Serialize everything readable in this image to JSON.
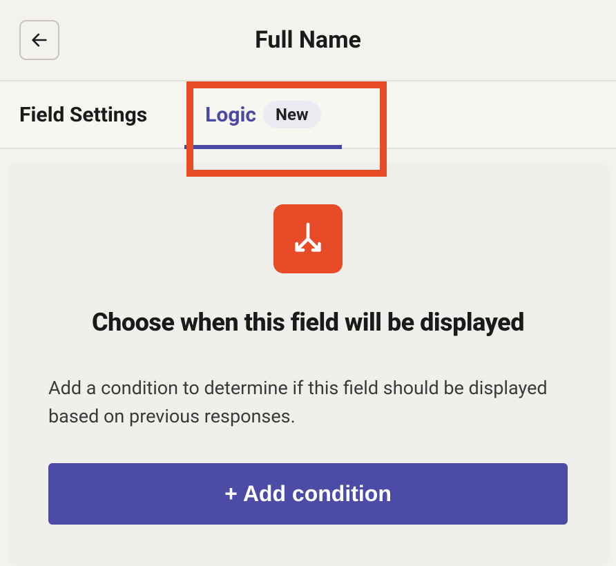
{
  "header": {
    "title": "Full Name"
  },
  "tabs": {
    "fieldSettings": {
      "label": "Field Settings"
    },
    "logic": {
      "label": "Logic",
      "badge": "New"
    }
  },
  "card": {
    "title": "Choose when this field will be displayed",
    "description": "Add a condition to determine if this field should be displayed based on previous responses.",
    "buttonLabel": "Add condition"
  }
}
